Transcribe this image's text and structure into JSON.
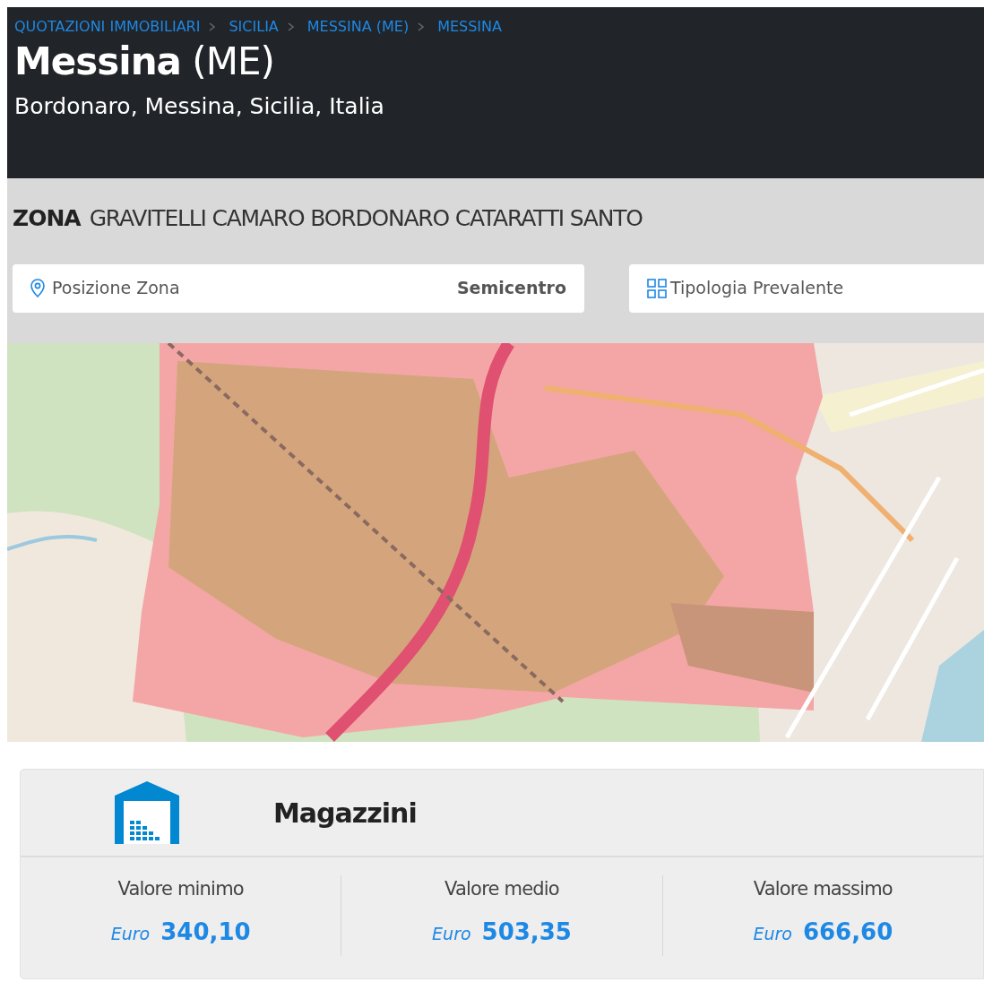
{
  "breadcrumb": [
    {
      "label": "QUOTAZIONI IMMOBILIARI"
    },
    {
      "label": "SICILIA"
    },
    {
      "label": "MESSINA (ME)"
    },
    {
      "label": "MESSINA"
    }
  ],
  "title": "**Messina** (ME)",
  "subtitle": "Bordonaro, Messina, Sicilia, Italia",
  "zone": {
    "label": "ZONA",
    "name": "GRAVITELLI CAMARO BORDONARO CATARATTI SANTO"
  },
  "info_cards": [
    {
      "kind": "position",
      "label": "Posizione Zona",
      "value": "Semicentro"
    },
    {
      "kind": "typology",
      "label": "Tipologia Prevalente"
    }
  ],
  "price_card": {
    "title": "Magazzini",
    "values": [
      {
        "label": "Valore minimo",
        "currency": "Euro",
        "amount": "340,10"
      },
      {
        "label": "Valore medio",
        "currency": "Euro",
        "amount": "503,35"
      },
      {
        "label": "Valore massimo",
        "currency": "Euro",
        "amount": "666,60"
      }
    ]
  }
}
